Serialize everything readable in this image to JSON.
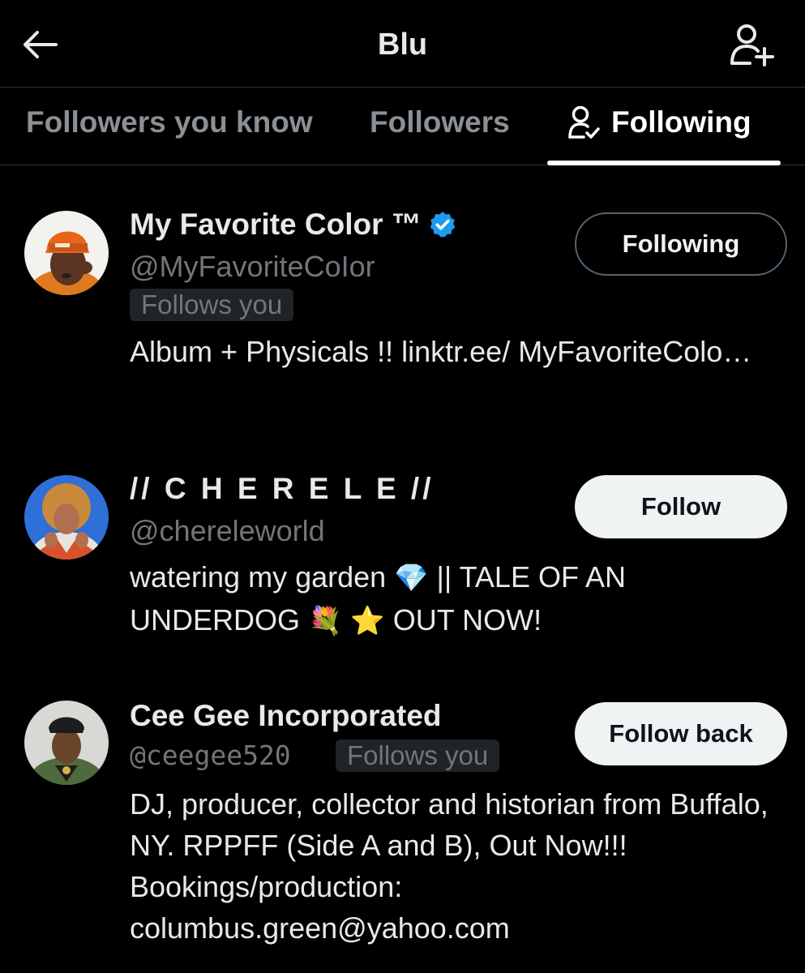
{
  "header": {
    "title": "Blu"
  },
  "tabs": [
    {
      "label": "Followers you know"
    },
    {
      "label": "Followers"
    },
    {
      "label": "Following"
    }
  ],
  "users": [
    {
      "name": "My Favorite Color ™",
      "handle": "@MyFavoriteCoIor",
      "follows_you": "Follows you",
      "bio": "Album + Physicals !! linktr.ee/ MyFavoriteColo…",
      "button": "Following",
      "verified": true
    },
    {
      "name": "// C H E R E L E //",
      "handle": "@chereleworld",
      "bio_part1": "watering my garden",
      "bio_emoji1": "💎",
      "bio_part2": "|| TALE OF AN UNDERDOG",
      "bio_emoji2": "💐",
      "bio_emoji3": "⭐",
      "bio_part3": "OUT NOW!",
      "button": "Follow"
    },
    {
      "name": "Cee Gee Incorporated",
      "handle": "@ceegee520",
      "follows_you": "Follows you",
      "bio": "DJ, producer, collector and historian from Buffalo, NY. RPPFF (Side A and B), Out Now!!! Bookings/production: columbus.green@yahoo.com",
      "button": "Follow back"
    }
  ],
  "colors": {
    "background": "#000000",
    "verified": "#1d9bf0",
    "muted": "#71767b"
  }
}
